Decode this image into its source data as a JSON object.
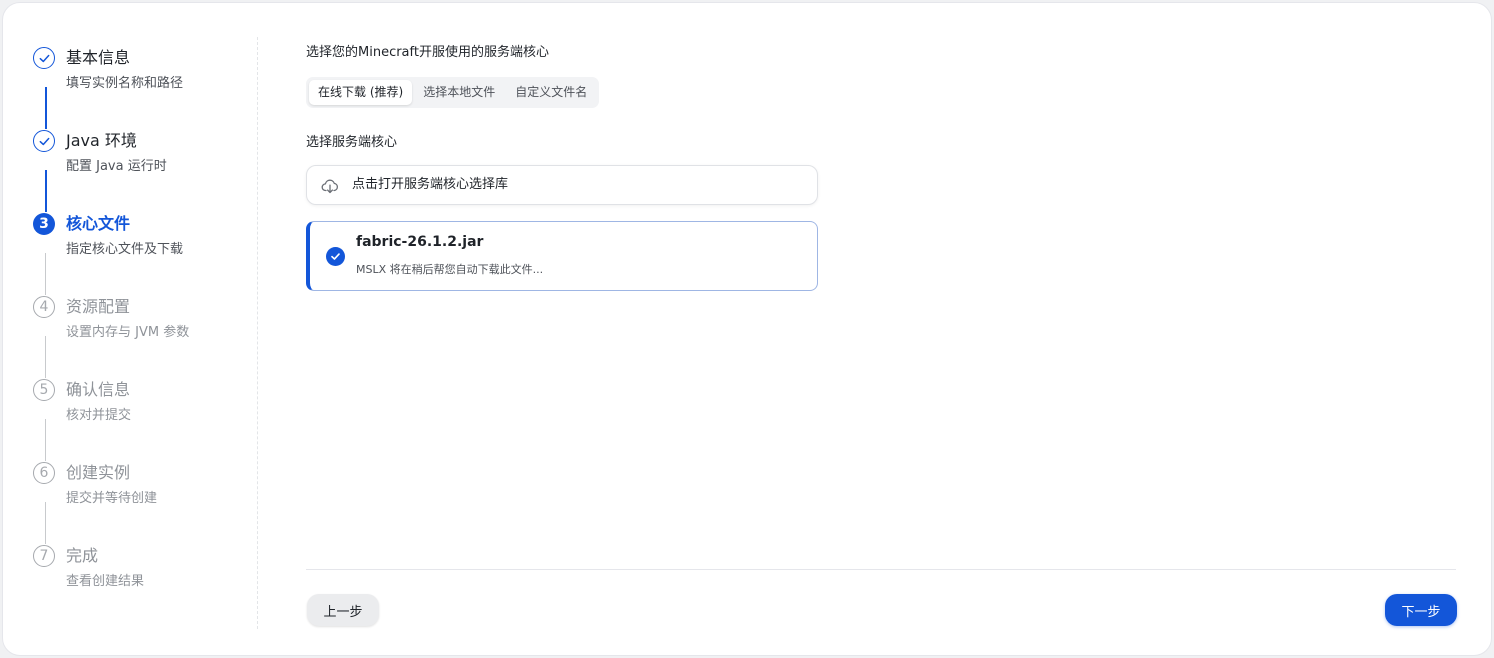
{
  "steps": [
    {
      "number": "1",
      "title": "基本信息",
      "desc": "填写实例名称和路径",
      "status": "done"
    },
    {
      "number": "2",
      "title": "Java 环境",
      "desc": "配置 Java 运行时",
      "status": "done"
    },
    {
      "number": "3",
      "title": "核心文件",
      "desc": "指定核心文件及下载",
      "status": "current"
    },
    {
      "number": "4",
      "title": "资源配置",
      "desc": "设置内存与 JVM 参数",
      "status": "pending"
    },
    {
      "number": "5",
      "title": "确认信息",
      "desc": "核对并提交",
      "status": "pending"
    },
    {
      "number": "6",
      "title": "创建实例",
      "desc": "提交并等待创建",
      "status": "pending"
    },
    {
      "number": "7",
      "title": "完成",
      "desc": "查看创建结果",
      "status": "pending"
    }
  ],
  "main": {
    "heading": "选择您的Minecraft开服使用的服务端核心",
    "source_tabs": [
      {
        "label": "在线下载 (推荐)",
        "active": true
      },
      {
        "label": "选择本地文件",
        "active": false
      },
      {
        "label": "自定义文件名",
        "active": false
      }
    ],
    "core_label": "选择服务端核心",
    "open_library_label": "点击打开服务端核心选择库",
    "selected_file": {
      "name": "fabric-26.1.2.jar",
      "desc": "MSLX 将在稍后帮您自动下载此文件..."
    }
  },
  "footer": {
    "prev_label": "上一步",
    "next_label": "下一步"
  },
  "colors": {
    "accent": "#1356d9",
    "pending": "#a6a9ae"
  },
  "icons": {
    "done": "check-icon",
    "cloud": "cloud-download-icon",
    "selected": "check-circle-icon"
  }
}
